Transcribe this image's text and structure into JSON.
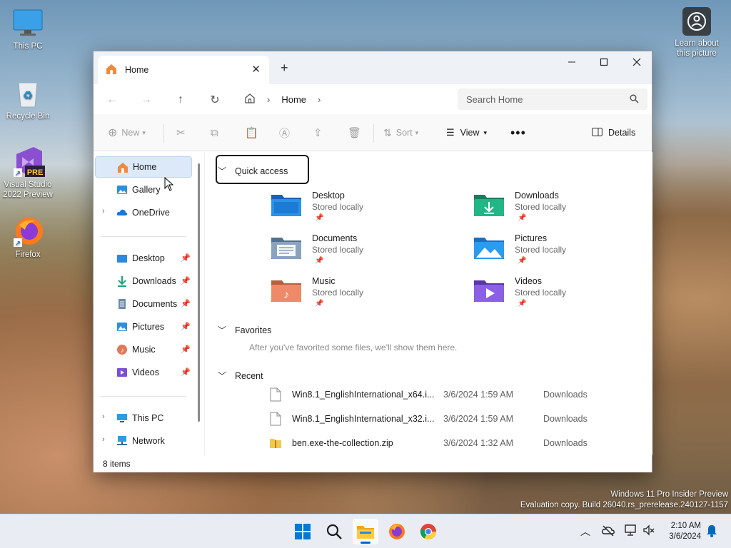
{
  "desktop": {
    "icons": [
      {
        "label": "This PC"
      },
      {
        "label": "Recycle Bin"
      },
      {
        "label": "Visual Studio 2022 Preview",
        "badge": "PRE"
      },
      {
        "label": "Firefox"
      }
    ],
    "learn_label": "Learn about this picture",
    "watermark_line1": "Windows 11 Pro Insider Preview",
    "watermark_line2": "Evaluation copy. Build 26040.rs_prerelease.240127-1157"
  },
  "window": {
    "tab_title": "Home",
    "address_crumb": "Home",
    "search_placeholder": "Search Home",
    "toolbar": {
      "new_label": "New",
      "sort_label": "Sort",
      "view_label": "View",
      "details_label": "Details"
    },
    "sidebar": {
      "top": [
        {
          "label": "Home",
          "selected": true
        },
        {
          "label": "Gallery"
        },
        {
          "label": "OneDrive"
        }
      ],
      "pinned": [
        {
          "label": "Desktop"
        },
        {
          "label": "Downloads"
        },
        {
          "label": "Documents"
        },
        {
          "label": "Pictures"
        },
        {
          "label": "Music"
        },
        {
          "label": "Videos"
        }
      ],
      "bottom": [
        {
          "label": "This PC"
        },
        {
          "label": "Network"
        }
      ]
    },
    "quick_access": {
      "title": "Quick access",
      "items": [
        {
          "name": "Desktop",
          "sub": "Stored locally",
          "color": "#1f7ed6"
        },
        {
          "name": "Downloads",
          "sub": "Stored locally",
          "color": "#1aa57a"
        },
        {
          "name": "Documents",
          "sub": "Stored locally",
          "color": "#6f8aa8"
        },
        {
          "name": "Pictures",
          "sub": "Stored locally",
          "color": "#2a8fe0"
        },
        {
          "name": "Music",
          "sub": "Stored locally",
          "color": "#e0785a"
        },
        {
          "name": "Videos",
          "sub": "Stored locally",
          "color": "#7a4fd6"
        }
      ]
    },
    "favorites": {
      "title": "Favorites",
      "empty_text": "After you've favorited some files, we'll show them here."
    },
    "recent": {
      "title": "Recent",
      "rows": [
        {
          "name": "Win8.1_EnglishInternational_x64.i...",
          "date": "3/6/2024 1:59 AM",
          "location": "Downloads",
          "type": "file"
        },
        {
          "name": "Win8.1_EnglishInternational_x32.i...",
          "date": "3/6/2024 1:59 AM",
          "location": "Downloads",
          "type": "file"
        },
        {
          "name": "ben.exe-the-collection.zip",
          "date": "3/6/2024 1:32 AM",
          "location": "Downloads",
          "type": "zip"
        }
      ]
    },
    "status": "8 items"
  },
  "taskbar": {
    "time": "2:10 AM",
    "date": "3/6/2024"
  },
  "colors": {
    "accent": "#0067c0",
    "selection": "#dce9f8"
  }
}
